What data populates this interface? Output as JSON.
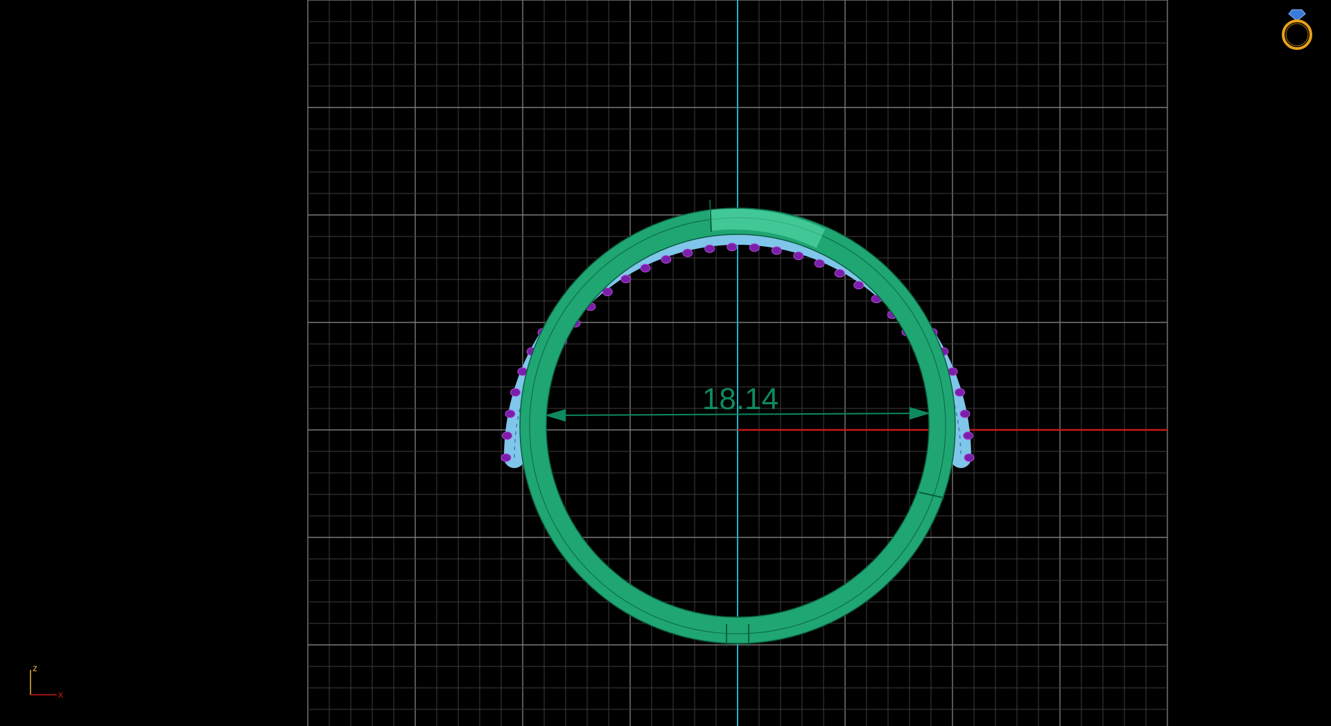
{
  "viewport": {
    "dimension_label": "18.14",
    "axis_labels": {
      "vertical": "z",
      "horizontal": "x"
    },
    "colors": {
      "background": "#000000",
      "grid_minor": "#3e3e3e",
      "grid_major": "#7a7a7a",
      "vertical_axis": "#1fb5c4",
      "horizontal_axis": "#c81818",
      "ring_metal": "#1fa673",
      "ring_highlight": "#5ce3b2",
      "gem_seat": "#7fc6ea",
      "prongs": "#7a1fa8",
      "dimension": "#0f8a5e",
      "axis_indicator": "#e8b23a",
      "ring_icon": "#e8a21a",
      "ring_icon_gem": "#3a7ad8"
    },
    "icons": {
      "ring_badge": "ring-with-diamond-icon",
      "axis_indicator": "axis-gizmo-icon"
    }
  }
}
